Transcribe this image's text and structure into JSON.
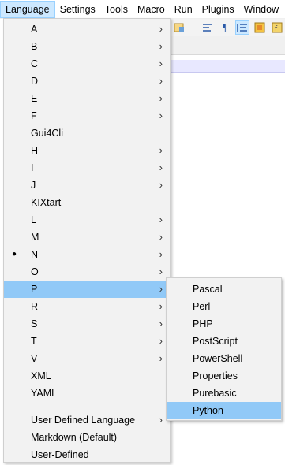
{
  "menubar": {
    "items": [
      "Language",
      "Settings",
      "Tools",
      "Macro",
      "Run",
      "Plugins",
      "Window"
    ]
  },
  "language_menu": {
    "items": [
      {
        "label": "A",
        "submenu": true
      },
      {
        "label": "B",
        "submenu": true
      },
      {
        "label": "C",
        "submenu": true
      },
      {
        "label": "D",
        "submenu": true
      },
      {
        "label": "E",
        "submenu": true
      },
      {
        "label": "F",
        "submenu": true
      },
      {
        "label": "Gui4Cli",
        "submenu": false
      },
      {
        "label": "H",
        "submenu": true
      },
      {
        "label": "I",
        "submenu": true
      },
      {
        "label": "J",
        "submenu": true
      },
      {
        "label": "KIXtart",
        "submenu": false
      },
      {
        "label": "L",
        "submenu": true
      },
      {
        "label": "M",
        "submenu": true
      },
      {
        "label": "N",
        "submenu": true,
        "selected": true
      },
      {
        "label": "O",
        "submenu": true
      },
      {
        "label": "P",
        "submenu": true,
        "highlighted": true
      },
      {
        "label": "R",
        "submenu": true
      },
      {
        "label": "S",
        "submenu": true
      },
      {
        "label": "T",
        "submenu": true
      },
      {
        "label": "V",
        "submenu": true
      },
      {
        "label": "XML",
        "submenu": false
      },
      {
        "label": "YAML",
        "submenu": false
      }
    ],
    "extra_items": [
      {
        "label": "User Defined Language",
        "submenu": true
      },
      {
        "label": "Markdown (Default)",
        "submenu": false
      },
      {
        "label": "User-Defined",
        "submenu": false
      }
    ],
    "bullet": "●",
    "arrow": "›"
  },
  "p_submenu": {
    "items": [
      "Pascal",
      "Perl",
      "PHP",
      "PostScript",
      "PowerShell",
      "Properties",
      "Purebasic",
      "Python"
    ],
    "highlighted": "Python"
  },
  "colors": {
    "highlight": "#91c9f7",
    "menubar_active": "#cce8ff",
    "menu_bg": "#f2f2f2"
  }
}
